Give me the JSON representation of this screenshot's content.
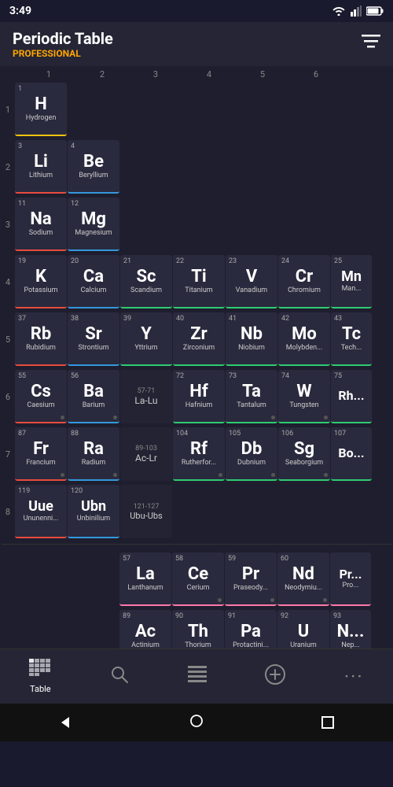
{
  "statusBar": {
    "time": "3:49"
  },
  "header": {
    "title": "Periodic Table",
    "subtitle": "PROFESSIONAL",
    "filterIcon": "≡"
  },
  "colHeaders": [
    "1",
    "2",
    "3",
    "4",
    "5",
    "6"
  ],
  "rows": [
    {
      "rowNum": "1",
      "elements": [
        {
          "num": "1",
          "symbol": "H",
          "name": "Hydrogen",
          "cat": "nonmetal",
          "col": 1
        }
      ]
    },
    {
      "rowNum": "2",
      "elements": [
        {
          "num": "3",
          "symbol": "Li",
          "name": "Lithium",
          "cat": "alkali-metal",
          "col": 1
        },
        {
          "num": "4",
          "symbol": "Be",
          "name": "Beryllium",
          "cat": "alkaline-earth",
          "col": 2
        }
      ]
    },
    {
      "rowNum": "3",
      "elements": [
        {
          "num": "11",
          "symbol": "Na",
          "name": "Sodium",
          "cat": "alkali-metal",
          "col": 1
        },
        {
          "num": "12",
          "symbol": "Mg",
          "name": "Magnesium",
          "cat": "alkaline-earth",
          "col": 2
        }
      ]
    },
    {
      "rowNum": "4",
      "elements": [
        {
          "num": "19",
          "symbol": "K",
          "name": "Potassium",
          "cat": "alkali-metal",
          "col": 1
        },
        {
          "num": "20",
          "symbol": "Ca",
          "name": "Calcium",
          "cat": "alkaline-earth",
          "col": 2
        },
        {
          "num": "21",
          "symbol": "Sc",
          "name": "Scandium",
          "cat": "transition-metal",
          "col": 3
        },
        {
          "num": "22",
          "symbol": "Ti",
          "name": "Titanium",
          "cat": "transition-metal",
          "col": 4
        },
        {
          "num": "23",
          "symbol": "V",
          "name": "Vanadium",
          "cat": "transition-metal",
          "col": 5
        },
        {
          "num": "24",
          "symbol": "Cr",
          "name": "Chromium",
          "cat": "transition-metal",
          "col": 6
        },
        {
          "num": "25",
          "symbol": "Mn",
          "name": "Man...",
          "cat": "transition-metal",
          "col": 7
        }
      ]
    },
    {
      "rowNum": "5",
      "elements": [
        {
          "num": "37",
          "symbol": "Rb",
          "name": "Rubidium",
          "cat": "alkali-metal",
          "col": 1
        },
        {
          "num": "38",
          "symbol": "Sr",
          "name": "Strontium",
          "cat": "alkaline-earth",
          "col": 2
        },
        {
          "num": "39",
          "symbol": "Y",
          "name": "Yttrium",
          "cat": "transition-metal",
          "col": 3
        },
        {
          "num": "40",
          "symbol": "Zr",
          "name": "Zirconium",
          "cat": "transition-metal",
          "col": 4
        },
        {
          "num": "41",
          "symbol": "Nb",
          "name": "Niobium",
          "cat": "transition-metal",
          "col": 5
        },
        {
          "num": "42",
          "symbol": "Mo",
          "name": "Molybden...",
          "cat": "transition-metal",
          "col": 6
        },
        {
          "num": "43",
          "symbol": "Tc",
          "name": "Tech...",
          "cat": "transition-metal",
          "col": 7
        }
      ]
    },
    {
      "rowNum": "6",
      "elements": [
        {
          "num": "55",
          "symbol": "Cs",
          "name": "Caesium",
          "cat": "alkali-metal",
          "col": 1
        },
        {
          "num": "56",
          "symbol": "Ba",
          "name": "Barium",
          "cat": "alkaline-earth",
          "col": 2
        },
        {
          "num": "57-71",
          "symbol": "La-Lu",
          "name": "",
          "cat": "range",
          "col": 3
        },
        {
          "num": "72",
          "symbol": "Hf",
          "name": "Hafnium",
          "cat": "transition-metal",
          "col": 4
        },
        {
          "num": "73",
          "symbol": "Ta",
          "name": "Tantalum",
          "cat": "transition-metal",
          "col": 5
        },
        {
          "num": "74",
          "symbol": "W",
          "name": "Tungsten",
          "cat": "transition-metal",
          "col": 6
        },
        {
          "num": "75",
          "symbol": "Rh...",
          "name": "Rh...",
          "cat": "transition-metal",
          "col": 7
        }
      ]
    },
    {
      "rowNum": "7",
      "elements": [
        {
          "num": "87",
          "symbol": "Fr",
          "name": "Francium",
          "cat": "alkali-metal",
          "col": 1
        },
        {
          "num": "88",
          "symbol": "Ra",
          "name": "Radium",
          "cat": "alkaline-earth",
          "col": 2
        },
        {
          "num": "89-103",
          "symbol": "Ac-Lr",
          "name": "",
          "cat": "range",
          "col": 3
        },
        {
          "num": "104",
          "symbol": "Rf",
          "name": "Rutherfor...",
          "cat": "transition-metal",
          "col": 4
        },
        {
          "num": "105",
          "symbol": "Db",
          "name": "Dubnium",
          "cat": "transition-metal",
          "col": 5
        },
        {
          "num": "106",
          "symbol": "Sg",
          "name": "Seaborgium",
          "cat": "transition-metal",
          "col": 6
        },
        {
          "num": "107",
          "symbol": "Bo...",
          "name": "Bo...",
          "cat": "transition-metal",
          "col": 7
        }
      ]
    },
    {
      "rowNum": "8",
      "elements": [
        {
          "num": "119",
          "symbol": "Uue",
          "name": "Ununenni...",
          "cat": "alkali-metal",
          "col": 1
        },
        {
          "num": "120",
          "symbol": "Ubn",
          "name": "Unbinilium",
          "cat": "alkaline-earth",
          "col": 2
        },
        {
          "num": "121-127",
          "symbol": "Ubu-Ubs",
          "name": "",
          "cat": "range",
          "col": 3
        }
      ]
    }
  ],
  "lanthanideRow": [
    {
      "num": "57",
      "symbol": "La",
      "name": "Lanthanum",
      "cat": "lanthanide"
    },
    {
      "num": "58",
      "symbol": "Ce",
      "name": "Cerium",
      "cat": "lanthanide"
    },
    {
      "num": "59",
      "symbol": "Pr",
      "name": "Praseody...",
      "cat": "lanthanide"
    },
    {
      "num": "60",
      "symbol": "Nd",
      "name": "Neodymiu...",
      "cat": "lanthanide"
    },
    {
      "num": "...",
      "symbol": "Pr...",
      "name": "Pro...",
      "cat": "lanthanide"
    }
  ],
  "actinideRow": [
    {
      "num": "89",
      "symbol": "Ac",
      "name": "Actinium",
      "cat": "actinide"
    },
    {
      "num": "90",
      "symbol": "Th",
      "name": "Thorium",
      "cat": "actinide"
    },
    {
      "num": "91",
      "symbol": "Pa",
      "name": "Protactini...",
      "cat": "actinide"
    },
    {
      "num": "92",
      "symbol": "U",
      "name": "Uranium",
      "cat": "actinide"
    },
    {
      "num": "93",
      "symbol": "N...",
      "name": "Nep...",
      "cat": "actinide"
    }
  ],
  "bottomNav": {
    "items": [
      {
        "id": "table",
        "label": "Table",
        "icon": "⊞",
        "active": true
      },
      {
        "id": "search",
        "label": "",
        "icon": "🔍",
        "active": false
      },
      {
        "id": "list",
        "label": "",
        "icon": "☰",
        "active": false
      },
      {
        "id": "add",
        "label": "",
        "icon": "⊕",
        "active": false
      },
      {
        "id": "more",
        "label": "",
        "icon": "···",
        "active": false
      }
    ]
  },
  "androidNav": {
    "back": "◀",
    "home": "●",
    "recents": "■"
  }
}
